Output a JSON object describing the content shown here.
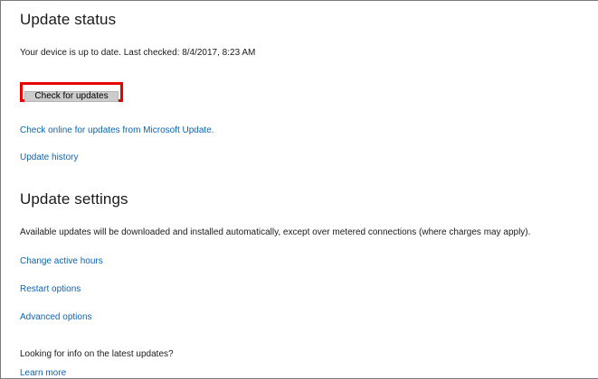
{
  "update_status": {
    "heading": "Update status",
    "status_text": "Your device is up to date. Last checked: 8/4/2017, 8:23 AM",
    "check_button_label": "Check for updates",
    "check_online_link": "Check online for updates from Microsoft Update.",
    "history_link": "Update history"
  },
  "update_settings": {
    "heading": "Update settings",
    "description": "Available updates will be downloaded and installed automatically, except over metered connections (where charges may apply).",
    "active_hours_link": "Change active hours",
    "restart_options_link": "Restart options",
    "advanced_options_link": "Advanced options"
  },
  "info": {
    "question": "Looking for info on the latest updates?",
    "learn_more_link": "Learn more"
  },
  "colors": {
    "link": "#0a64b4",
    "highlight_outline": "#e60000",
    "button_bg": "#cccccc"
  }
}
